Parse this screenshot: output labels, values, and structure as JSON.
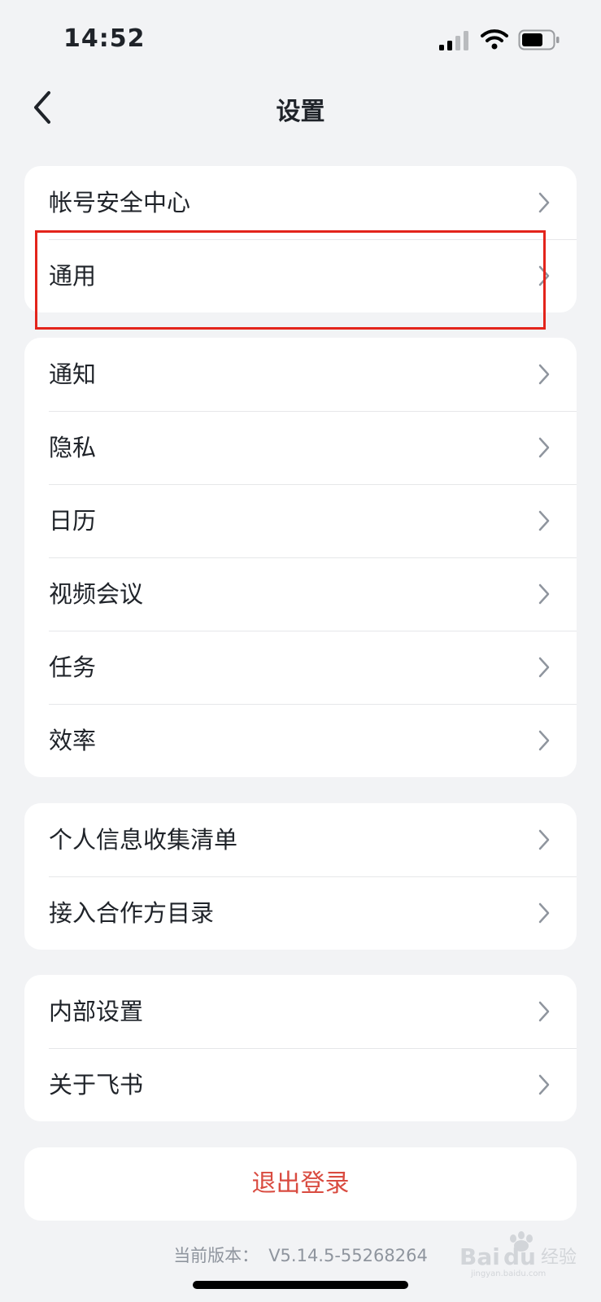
{
  "status_bar": {
    "time": "14:52"
  },
  "nav": {
    "title": "设置"
  },
  "groups": [
    {
      "items": [
        "帐号安全中心",
        "通用"
      ]
    },
    {
      "items": [
        "通知",
        "隐私",
        "日历",
        "视频会议",
        "任务",
        "效率"
      ]
    },
    {
      "items": [
        "个人信息收集清单",
        "接入合作方目录"
      ]
    },
    {
      "items": [
        "内部设置",
        "关于飞书"
      ]
    }
  ],
  "logout": {
    "label": "退出登录"
  },
  "version": {
    "label": "当前版本：",
    "value": "V5.14.5-55268264"
  },
  "watermark": {
    "text": "Baidu经验",
    "subtext": "jingyan.baidu.com"
  },
  "colors": {
    "background": "#f2f3f5",
    "card": "#ffffff",
    "logout_text": "#d94b40",
    "highlight_box": "#e3241b"
  },
  "icons": [
    "back-icon",
    "chevron-right-icon",
    "signal-icon",
    "wifi-icon",
    "battery-icon"
  ]
}
